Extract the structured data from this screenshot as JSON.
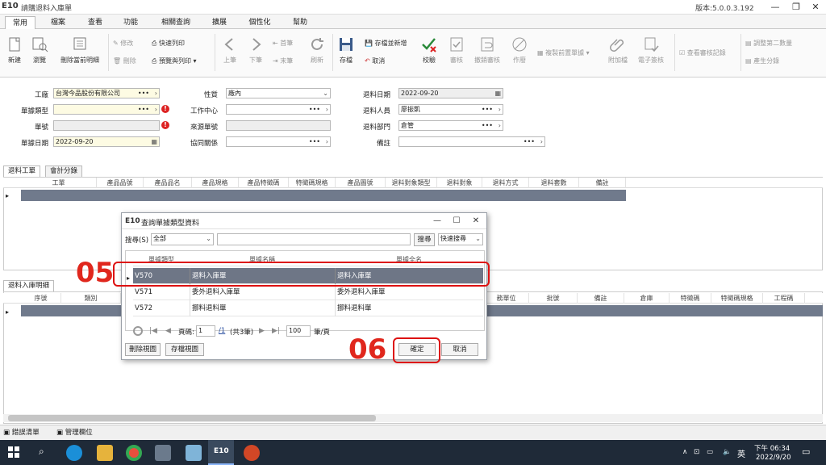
{
  "app": {
    "logo": "E10",
    "window_title": "請購退料入庫單",
    "version": "版本:5.0.0.3.192"
  },
  "menu_tabs": [
    "常用",
    "檔案",
    "查看",
    "功能",
    "相關查詢",
    "擴展",
    "個性化",
    "幫助"
  ],
  "ribbon": {
    "new": "新建",
    "browse": "瀏覽",
    "delete_details": "刪除當前明細",
    "modify": "修改",
    "delete": "刪除",
    "quick_print": "快速列印",
    "preview_print": "預覽與列印",
    "prev": "上筆",
    "next": "下筆",
    "first": "首筆",
    "last": "末筆",
    "refresh": "刷新",
    "save": "存檔",
    "save_new": "存檔並新增",
    "cancel": "取消",
    "validate": "校驗",
    "audit": "審核",
    "unaudit": "撤銷審核",
    "void": "作廢",
    "copy_prev": "複製前置單據",
    "attach": "附加檔",
    "esign": "電子簽核",
    "audit_log": "查看審核記錄",
    "adjust_qty": "調整第二數量",
    "gen_batch": "產生分錄"
  },
  "form": {
    "factory_label": "工廠",
    "factory_value": "台灣今品股份有限公司",
    "doctype_label": "單據類型",
    "docno_label": "單號",
    "docdate_label": "單據日期",
    "docdate_value": "2022-09-20",
    "nature_label": "性質",
    "nature_value": "廠內",
    "workcenter_label": "工作中心",
    "source_label": "來源單號",
    "coop_label": "協同關係",
    "retdate_label": "退料日期",
    "retdate_value": "2022-09-20",
    "retperson_label": "退料人員",
    "retperson_value": "廖振凱",
    "retdept_label": "退料部門",
    "retdept_value": "倉管",
    "remark_label": "備註"
  },
  "grid1": {
    "tabs": [
      "退料工單",
      "會計分錄"
    ],
    "columns": [
      "工單",
      "產品品號",
      "產品品名",
      "產品規格",
      "產品特徵碼",
      "特徵碼規格",
      "產品圖號",
      "退料對象類型",
      "退料對象",
      "退料方式",
      "退料套數",
      "備註"
    ]
  },
  "grid2": {
    "tab": "退料入庫明細",
    "columns_left": [
      "序號",
      "類別"
    ],
    "columns_right": [
      "務單位",
      "批號",
      "備註",
      "倉庫",
      "特徵碼",
      "特徵碼規格",
      "工程碼"
    ]
  },
  "dialog": {
    "logo": "E10",
    "title": "查詢單據類型資料",
    "search_label": "搜尋(S)",
    "search_scope": "全部",
    "search_button": "搜尋",
    "quick_search": "快速搜尋",
    "columns": [
      "單據類型",
      "單據名稱",
      "單據全名"
    ],
    "rows": [
      {
        "code": "V570",
        "name": "退料入庫單",
        "fullname": "退料入庫單"
      },
      {
        "code": "V571",
        "name": "委外退料入庫單",
        "fullname": "委外退料入庫單"
      },
      {
        "code": "V572",
        "name": "挪料退料單",
        "fullname": "挪料退料單"
      }
    ],
    "selected_index": 0,
    "page_label": "頁碼:",
    "page_value": "1",
    "page_total": "/1",
    "record_count": "(共3筆)",
    "page_size": "100",
    "page_unit": "筆/頁",
    "delete_view": "刪除視圖",
    "save_view": "存檔視圖",
    "ok": "確定",
    "cancel": "取消"
  },
  "annotations": {
    "step_a": "05",
    "step_b": "06"
  },
  "bottom_tabs": [
    "錯誤清單",
    "管理欄位"
  ],
  "taskbar": {
    "tray_lang": "英",
    "time": "下午 06:34",
    "date": "2022/9/20"
  },
  "colors": {
    "accent_red": "#e0271d",
    "selected_row": "#6e7686",
    "required_field": "#fdfbe3",
    "taskbar": "#1f2a38"
  }
}
